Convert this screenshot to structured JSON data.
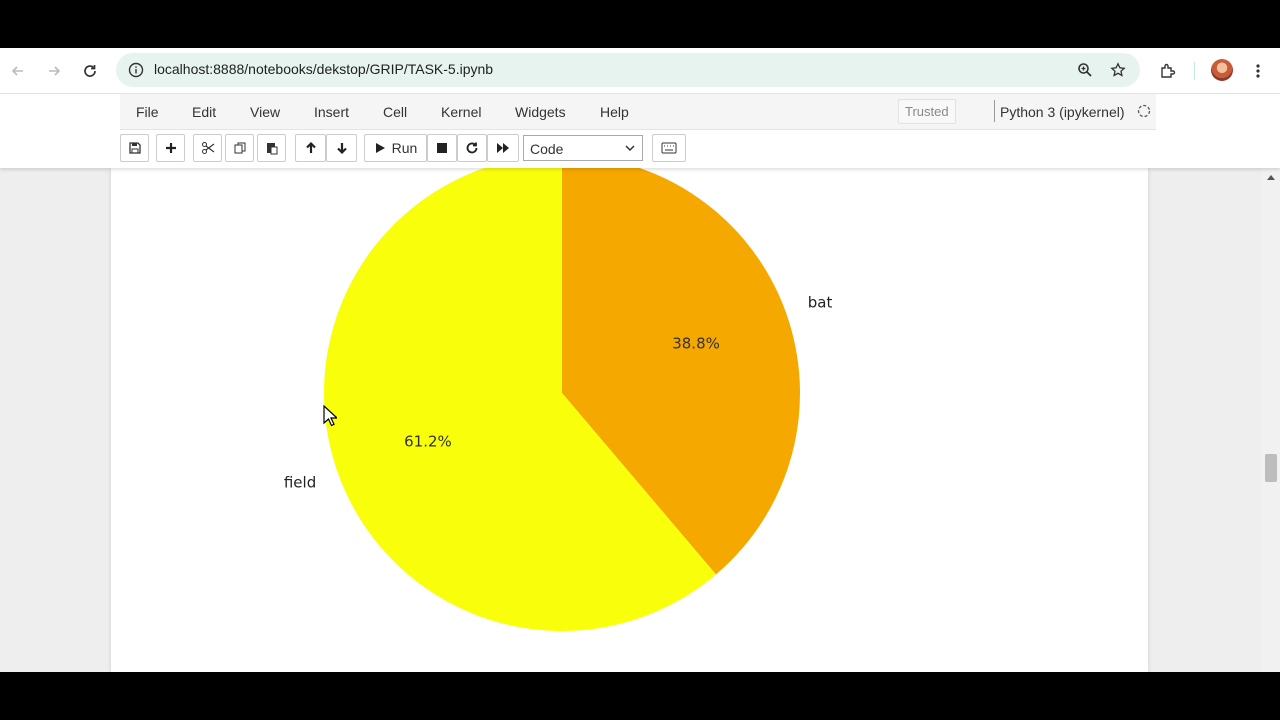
{
  "browser": {
    "url": "localhost:8888/notebooks/dekstop/GRIP/TASK-5.ipynb"
  },
  "jupyter": {
    "menu": [
      "File",
      "Edit",
      "View",
      "Insert",
      "Cell",
      "Kernel",
      "Widgets",
      "Help"
    ],
    "trusted_label": "Trusted",
    "kernel_label": "Python 3 (ipykernel)",
    "run_label": "Run",
    "cell_type": "Code"
  },
  "chart_data": {
    "type": "pie",
    "slices": [
      {
        "label": "bat",
        "value": 38.8,
        "autopct": "38.8%",
        "color": "#f5a800"
      },
      {
        "label": "field",
        "value": 61.2,
        "autopct": "61.2%",
        "color": "#f9ff0a"
      }
    ],
    "startangle": 90,
    "direction": "clockwise"
  },
  "colors": {
    "omnibox": "#e6f3ee",
    "menubar": "#f5f5f5"
  }
}
